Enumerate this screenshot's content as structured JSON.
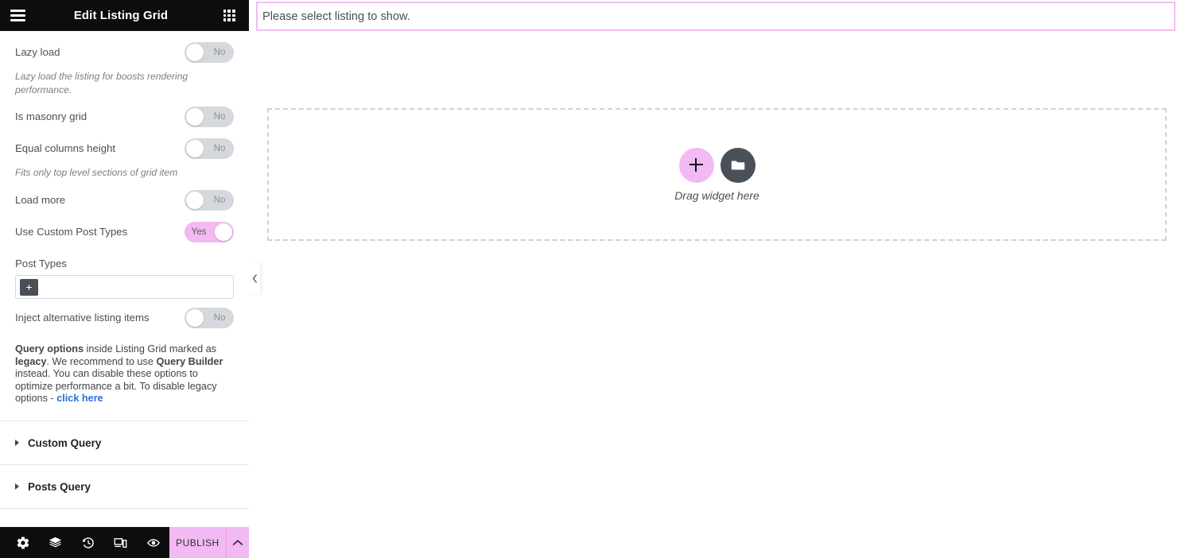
{
  "panel": {
    "header": {
      "title": "Edit Listing Grid",
      "menu_icon": "hamburger-icon",
      "widgets_icon": "apps-grid-icon"
    },
    "controls": [
      {
        "label": "Lazy load",
        "toggle": {
          "state": "off",
          "text": "No"
        },
        "description": "Lazy load the listing for boosts rendering performance."
      },
      {
        "label": "Is masonry grid",
        "toggle": {
          "state": "off",
          "text": "No"
        },
        "description": ""
      },
      {
        "label": "Equal columns height",
        "toggle": {
          "state": "off",
          "text": "No"
        },
        "description": "Fits only top level sections of grid item"
      },
      {
        "label": "Load more",
        "toggle": {
          "state": "off",
          "text": "No"
        },
        "description": ""
      },
      {
        "label": "Use Custom Post Types",
        "toggle": {
          "state": "on",
          "text": "Yes"
        },
        "description": ""
      }
    ],
    "post_types": {
      "label": "Post Types",
      "add_button": "+",
      "value": ""
    },
    "inject_control": {
      "label": "Inject alternative listing items",
      "toggle": {
        "state": "off",
        "text": "No"
      }
    },
    "notice": {
      "part1_bold": "Query options",
      "part2": " inside Listing Grid marked as ",
      "part3_bold": "legacy",
      "part4": ". We recommend to use ",
      "part5_bold": "Query Builder",
      "part6": " instead. You can disable these options to optimize performance a bit. To disable legacy options - ",
      "link": "click here"
    },
    "sections": [
      {
        "title": "Custom Query"
      },
      {
        "title": "Posts Query"
      }
    ],
    "footer": {
      "icons": [
        "settings-gear-icon",
        "navigator-layers-icon",
        "history-clock-icon",
        "responsive-mode-icon",
        "preview-eye-icon"
      ],
      "publish_label": "PUBLISH",
      "publish_caret": "chevron-up-icon"
    },
    "collapse_tab_icon": "chevron-left-icon"
  },
  "canvas": {
    "notice_text": "Please select listing to show.",
    "dropzone": {
      "add_icon": "plus-icon",
      "folder_icon": "folder-icon",
      "caption": "Drag widget here"
    }
  },
  "colors": {
    "header_bg": "#0c0d0e",
    "accent_pink": "#f3b9f3",
    "toggle_off": "#d5d8dc",
    "link_blue": "#2b6fd9",
    "notice_border": "#f2bdf4",
    "dashed_border": "#cfd3d9"
  }
}
